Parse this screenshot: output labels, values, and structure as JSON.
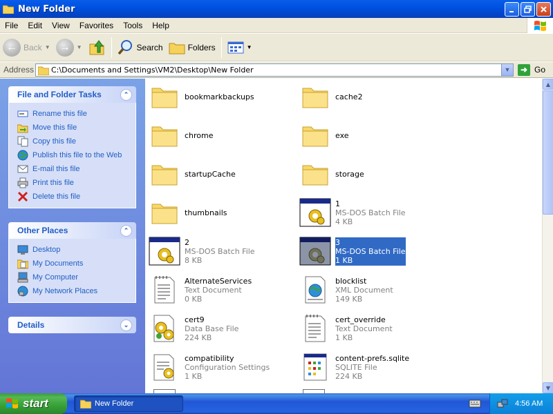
{
  "window": {
    "title": "New Folder"
  },
  "menubar": {
    "items": [
      "File",
      "Edit",
      "View",
      "Favorites",
      "Tools",
      "Help"
    ]
  },
  "toolbar": {
    "back": "Back",
    "search": "Search",
    "folders": "Folders"
  },
  "addressbar": {
    "label": "Address",
    "path": "C:\\Documents and Settings\\VM2\\Desktop\\New Folder",
    "go": "Go"
  },
  "tasks": {
    "title": "File and Folder Tasks",
    "items": [
      {
        "label": "Rename this file",
        "icon": "rename-icon"
      },
      {
        "label": "Move this file",
        "icon": "move-icon"
      },
      {
        "label": "Copy this file",
        "icon": "copy-icon"
      },
      {
        "label": "Publish this file to the Web",
        "icon": "publish-web-icon"
      },
      {
        "label": "E-mail this file",
        "icon": "email-icon"
      },
      {
        "label": "Print this file",
        "icon": "printer-icon"
      },
      {
        "label": "Delete this file",
        "icon": "delete-icon"
      }
    ]
  },
  "other_places": {
    "title": "Other Places",
    "items": [
      {
        "label": "Desktop",
        "icon": "desktop-icon"
      },
      {
        "label": "My Documents",
        "icon": "my-documents-icon"
      },
      {
        "label": "My Computer",
        "icon": "my-computer-icon"
      },
      {
        "label": "My Network Places",
        "icon": "network-places-icon"
      }
    ]
  },
  "details": {
    "title": "Details"
  },
  "files": [
    {
      "name": "bookmarkbackups",
      "type": "",
      "size": "",
      "kind": "folder"
    },
    {
      "name": "cache2",
      "type": "",
      "size": "",
      "kind": "folder"
    },
    {
      "name": "chrome",
      "type": "",
      "size": "",
      "kind": "folder"
    },
    {
      "name": "exe",
      "type": "",
      "size": "",
      "kind": "folder"
    },
    {
      "name": "startupCache",
      "type": "",
      "size": "",
      "kind": "folder"
    },
    {
      "name": "storage",
      "type": "",
      "size": "",
      "kind": "folder"
    },
    {
      "name": "thumbnails",
      "type": "",
      "size": "",
      "kind": "folder"
    },
    {
      "name": "1",
      "type": "MS-DOS Batch File",
      "size": "4 KB",
      "kind": "batch"
    },
    {
      "name": "2",
      "type": "MS-DOS Batch File",
      "size": "8 KB",
      "kind": "batch"
    },
    {
      "name": "3",
      "type": "MS-DOS Batch File",
      "size": "1 KB",
      "kind": "batch",
      "selected": true
    },
    {
      "name": "AlternateServices",
      "type": "Text Document",
      "size": "0 KB",
      "kind": "text"
    },
    {
      "name": "blocklist",
      "type": "XML Document",
      "size": "149 KB",
      "kind": "xml"
    },
    {
      "name": "cert9",
      "type": "Data Base File",
      "size": "224 KB",
      "kind": "database"
    },
    {
      "name": "cert_override",
      "type": "Text Document",
      "size": "1 KB",
      "kind": "text"
    },
    {
      "name": "compatibility",
      "type": "Configuration Settings",
      "size": "1 KB",
      "kind": "config"
    },
    {
      "name": "content-prefs.sqlite",
      "type": "SQLITE File",
      "size": "224 KB",
      "kind": "sqlite"
    }
  ],
  "taskbar": {
    "start": "start",
    "window_button": "New Folder",
    "clock": "4:56 AM"
  },
  "colors": {
    "titlebar": "#0055e5",
    "taskpane": "#6f8fe0",
    "link": "#215dc6",
    "selection": "#316ac5",
    "start": "#3c9b3c"
  }
}
